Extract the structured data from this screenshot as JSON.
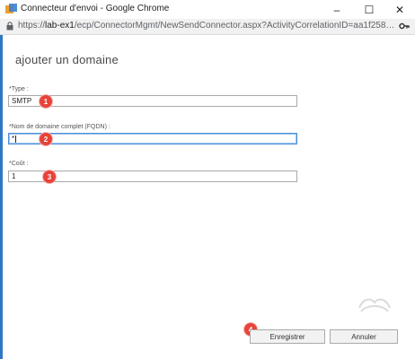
{
  "window": {
    "title": "Connecteur d'envoi - Google Chrome",
    "url_scheme": "https://",
    "url_host": "lab-ex1",
    "url_path": "/ecp/ConnectorMgmt/NewSendConnector.aspx?ActivityCorrelationID=aa1f2584-313...",
    "minimize_glyph": "–",
    "maximize_glyph": "☐",
    "close_glyph": "✕"
  },
  "dialog": {
    "heading": "ajouter un domaine",
    "fields": [
      {
        "label": "*Type :",
        "value": "SMTP",
        "marker": "1"
      },
      {
        "label": "*Nom de domaine complet (FQDN) :",
        "value": "*",
        "marker": "2"
      },
      {
        "label": "*Coût :",
        "value": "1",
        "marker": "3"
      }
    ],
    "save_label": "Enregistrer",
    "save_marker": "4",
    "cancel_label": "Annuler"
  },
  "colors": {
    "accent": "#2d78c4",
    "marker": "#e8433a"
  }
}
